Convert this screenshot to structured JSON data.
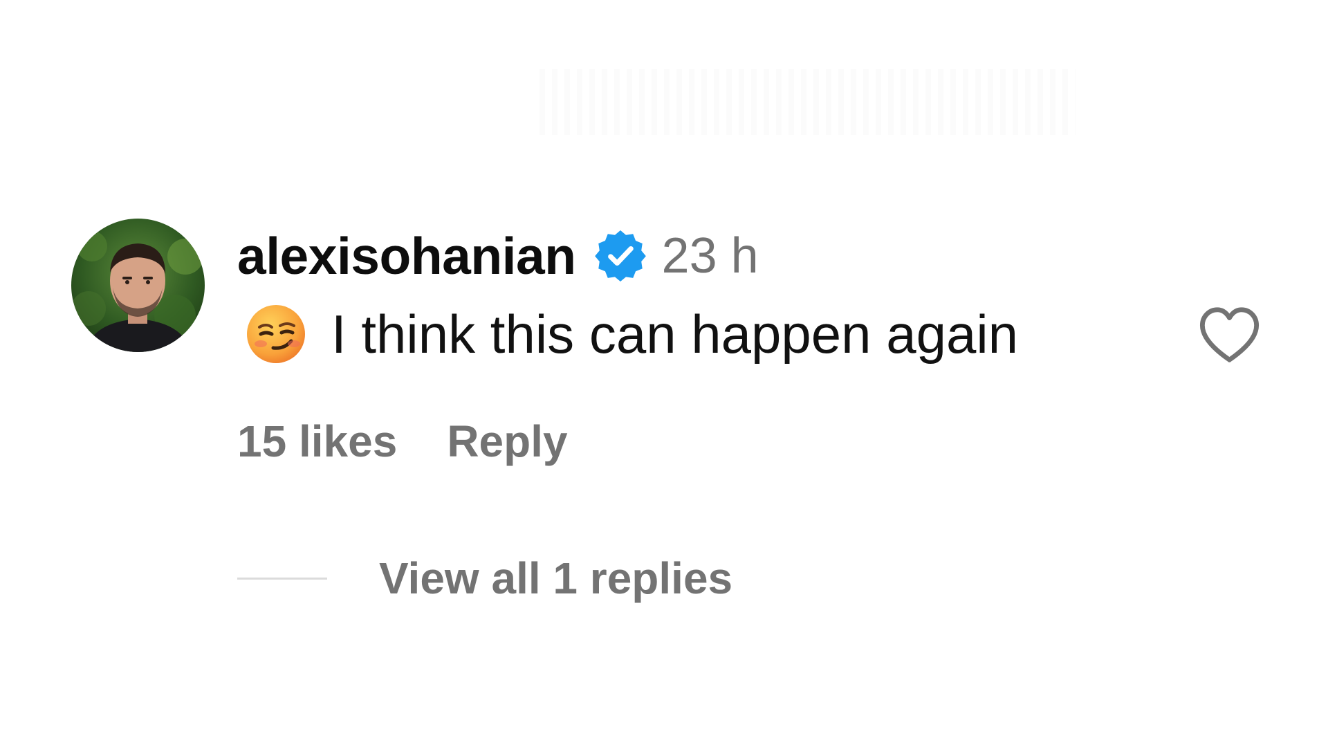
{
  "comment": {
    "username": "alexisohanian",
    "verified": true,
    "timestamp": "23 h",
    "emoji": "smirking-face",
    "text": "I think this can happen again",
    "likes_label": "15 likes",
    "reply_label": "Reply",
    "view_replies_label": "View all 1 replies",
    "like_icon": "heart-outline-icon"
  },
  "colors": {
    "username": "#0d0d0d",
    "secondary_text": "#737373",
    "verified_badge": "#1d9bf0",
    "divider": "#dbdbdb",
    "heart_outline": "#737373"
  }
}
